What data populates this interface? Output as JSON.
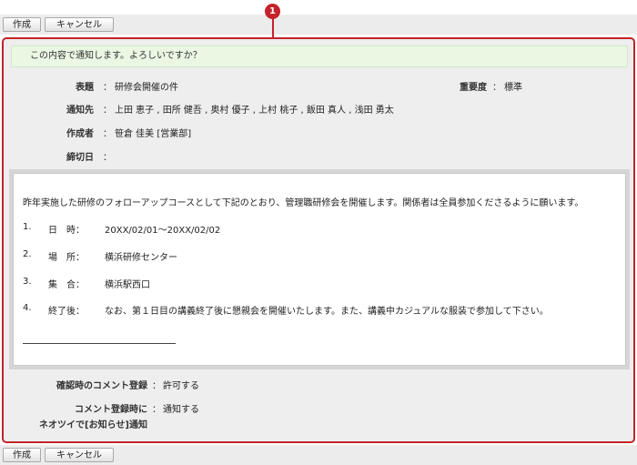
{
  "toolbar": {
    "create_label": "作成",
    "cancel_label": "キャンセル"
  },
  "callout": {
    "number": "1"
  },
  "confirm_message": "この内容で通知します。よろしいですか？",
  "fields": {
    "subject_label": "表題",
    "subject_value": "研修会開催の件",
    "importance_label": "重要度",
    "importance_value": "標準",
    "recipients_label": "通知先",
    "recipients_value": "上田 恵子 , 田所 健吾 , 奥村 優子 , 上村 桃子 , 飯田 真人 , 浅田 勇太",
    "author_label": "作成者",
    "author_value": "笹倉 佳美 [営業部]",
    "deadline_label": "締切日",
    "deadline_value": "",
    "colon": "："
  },
  "body": {
    "intro": "昨年実施した研修のフォローアップコースとして下記のとおり、管理職研修会を開催します。関係者は全員参加くださるように願います。",
    "items": [
      {
        "num": "1.",
        "key": "日　時：",
        "value": "20XX/02/01〜20XX/02/02"
      },
      {
        "num": "2.",
        "key": "場　所：",
        "value": "横浜研修センター"
      },
      {
        "num": "3.",
        "key": "集　合：",
        "value": "横浜駅西口"
      },
      {
        "num": "4.",
        "key": "終了後：",
        "value": "なお、第１日目の講義終了後に懇親会を開催いたします。また、講義中カジュアルな服装で参加して下さい。"
      }
    ]
  },
  "options": {
    "comment_confirm_label": "確認時のコメント登録",
    "comment_confirm_value": "許可する",
    "comment_notify_label_line1": "コメント登録時に",
    "comment_notify_label_line2": "ネオツイで[お知らせ]通知",
    "comment_notify_value": "通知する"
  },
  "colors": {
    "accent": "#c4232b",
    "confirm_bg": "#eaf7e3",
    "panel_bg": "#eeeeee"
  }
}
